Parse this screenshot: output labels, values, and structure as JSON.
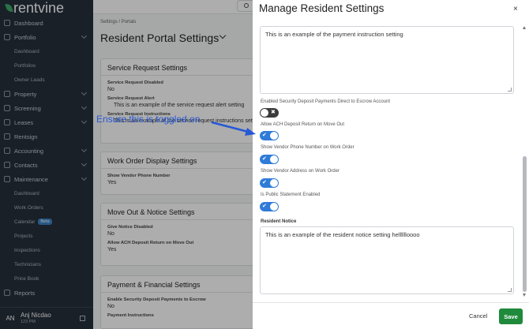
{
  "app": {
    "logo": "rentvine"
  },
  "sidebar": {
    "items": [
      {
        "label": "Dashboard"
      },
      {
        "label": "Portfolio",
        "expanded": true,
        "sub": [
          "Dashboard",
          "Portfolios",
          "Owner Leads"
        ]
      },
      {
        "label": "Property"
      },
      {
        "label": "Screening"
      },
      {
        "label": "Leases"
      },
      {
        "label": "Rentsign"
      },
      {
        "label": "Accounting"
      },
      {
        "label": "Contacts"
      },
      {
        "label": "Maintenance",
        "expanded": true,
        "sub": [
          "Dashboard",
          "Work Orders",
          "Calendar",
          "Projects",
          "Inspections",
          "Technicians",
          "Price Book"
        ]
      },
      {
        "label": "Reports"
      }
    ],
    "calendar_badge": "Beta",
    "user": {
      "initials": "AN",
      "name": "Anj Nicdao",
      "time": "123 PM"
    }
  },
  "page": {
    "breadcrumb": [
      "Settings",
      "Portals"
    ],
    "breadcrumb_sep": "/",
    "title": "Resident Portal Settings",
    "cards": [
      {
        "title": "Service Request Settings",
        "fields": [
          {
            "label": "Service Request Disabled",
            "value": "No"
          },
          {
            "label": "Service Request Alert",
            "value": "This is an example of the service request alert setting"
          },
          {
            "label": "Service Request Instructions",
            "value": "This is an example of the service request instructions setting"
          }
        ]
      },
      {
        "title": "Work Order Display Settings",
        "fields": [
          {
            "label": "Show Vendor Phone Number",
            "value": "Yes"
          }
        ]
      },
      {
        "title": "Move Out & Notice Settings",
        "fields": [
          {
            "label": "Give Notice Disabled",
            "value": "No"
          },
          {
            "label": "Allow ACH Deposit Return on Move Out",
            "value": "Yes"
          }
        ]
      },
      {
        "title": "Payment & Financial Settings",
        "fields": [
          {
            "label": "Enable Security Deposit Payments to Escrow",
            "value": "No"
          },
          {
            "label": "Payment Instructions",
            "value": ""
          }
        ]
      }
    ]
  },
  "modal": {
    "title": "Manage Resident Settings",
    "close": "×",
    "payment_instruction_text": "This is an example of the payment instruction setting",
    "settings": [
      {
        "label": "Enabled Security Deposit Payments Direct to Escrow Account",
        "on": false,
        "mark": "✖"
      },
      {
        "label": "Allow ACH Deposit Return on Move Out",
        "on": true,
        "mark": "✔"
      },
      {
        "label": "Show Vendor Phone Number on Work Order",
        "on": true,
        "mark": "✔"
      },
      {
        "label": "Show Vendor Address on Work Order",
        "on": true,
        "mark": "✔"
      },
      {
        "label": "Is Public Statement Enabled",
        "on": true,
        "mark": "✔"
      }
    ],
    "resident_notice_label": "Resident Notice",
    "resident_notice_text": "This is an example of the resident notice setting helllllloooo",
    "cancel": "Cancel",
    "save": "Save"
  },
  "annotation": {
    "text": "Ensure this is toggled on",
    "color": "#2658d6"
  },
  "colors": {
    "toggle_on": "#2f7bd9",
    "toggle_off": "#3c3c3c",
    "save": "#1f8a3b",
    "sidebar": "#26303c",
    "brand_leaf": "#3fa96b"
  }
}
